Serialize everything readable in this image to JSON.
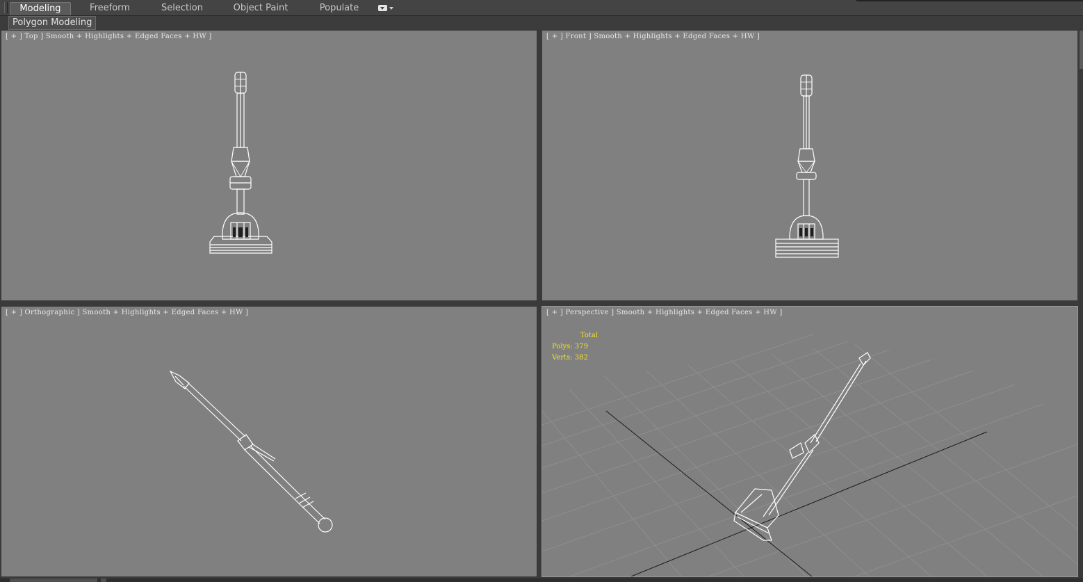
{
  "ribbon": {
    "tabs": [
      {
        "label": "Modeling",
        "active": true
      },
      {
        "label": "Freeform",
        "active": false
      },
      {
        "label": "Selection",
        "active": false
      },
      {
        "label": "Object Paint",
        "active": false
      },
      {
        "label": "Populate",
        "active": false
      }
    ],
    "dropdown_icon": "ribbon-options-icon",
    "panel": "Polygon Modeling"
  },
  "viewports": {
    "top": {
      "label": "[ + ] Top ] Smooth + Highlights + Edged Faces + HW ]"
    },
    "front": {
      "label": "[ + ] Front ] Smooth + Highlights + Edged Faces + HW ]"
    },
    "ortho": {
      "label": "[ + ] Orthographic ] Smooth + Highlights + Edged Faces + HW ]"
    },
    "persp": {
      "label": "[ + ] Perspective ] Smooth + Highlights + Edged Faces + HW ]"
    }
  },
  "stats": {
    "header": "Total",
    "polys_label": "Polys:",
    "polys": "379",
    "verts_label": "Verts:",
    "verts": "382"
  },
  "colors": {
    "viewport_bg": "#808080",
    "stats_text": "#f0e22a",
    "wire": "#ffffff",
    "edges": "#1a1a1a"
  }
}
